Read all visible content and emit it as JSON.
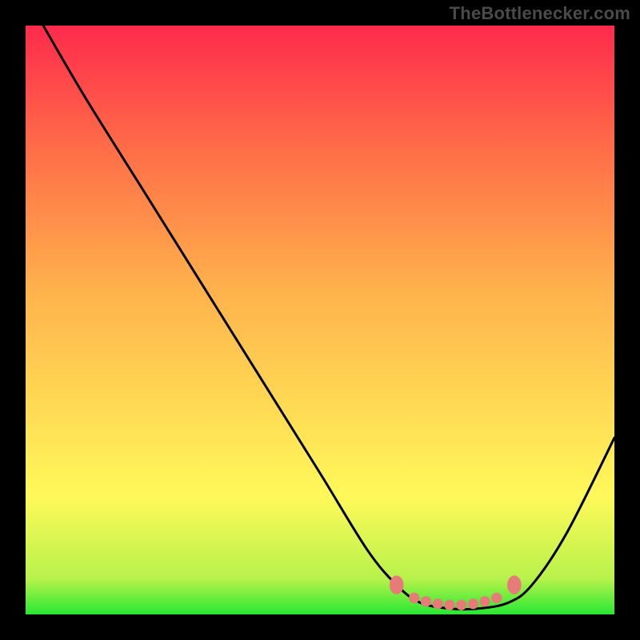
{
  "attribution": "TheBottlenecker.com",
  "chart_data": {
    "type": "line",
    "title": "",
    "xlabel": "",
    "ylabel": "",
    "xlim": [
      0,
      100
    ],
    "ylim": [
      0,
      100
    ],
    "gradient_stops": [
      {
        "offset": 0,
        "color": "#27e833"
      },
      {
        "offset": 6,
        "color": "#b7f24a"
      },
      {
        "offset": 20,
        "color": "#fff95a"
      },
      {
        "offset": 55,
        "color": "#ffb24c"
      },
      {
        "offset": 80,
        "color": "#ff6a48"
      },
      {
        "offset": 100,
        "color": "#ff2a4c"
      }
    ],
    "series": [
      {
        "name": "curve",
        "type": "line",
        "points": [
          {
            "x": 3,
            "y": 100
          },
          {
            "x": 10,
            "y": 88
          },
          {
            "x": 20,
            "y": 72
          },
          {
            "x": 30,
            "y": 56
          },
          {
            "x": 40,
            "y": 40
          },
          {
            "x": 50,
            "y": 24
          },
          {
            "x": 58,
            "y": 11
          },
          {
            "x": 63,
            "y": 5
          },
          {
            "x": 67,
            "y": 2
          },
          {
            "x": 72,
            "y": 1
          },
          {
            "x": 77,
            "y": 1
          },
          {
            "x": 82,
            "y": 2
          },
          {
            "x": 86,
            "y": 5
          },
          {
            "x": 92,
            "y": 14
          },
          {
            "x": 100,
            "y": 30
          }
        ]
      },
      {
        "name": "bottom-markers",
        "type": "marker",
        "marker_color": "#e67b78",
        "points": [
          {
            "x": 63,
            "y": 5
          },
          {
            "x": 66,
            "y": 2.8
          },
          {
            "x": 68,
            "y": 2.2
          },
          {
            "x": 70,
            "y": 1.8
          },
          {
            "x": 72,
            "y": 1.6
          },
          {
            "x": 74,
            "y": 1.6
          },
          {
            "x": 76,
            "y": 1.8
          },
          {
            "x": 78,
            "y": 2.2
          },
          {
            "x": 80,
            "y": 2.8
          },
          {
            "x": 83,
            "y": 5
          }
        ]
      }
    ]
  }
}
